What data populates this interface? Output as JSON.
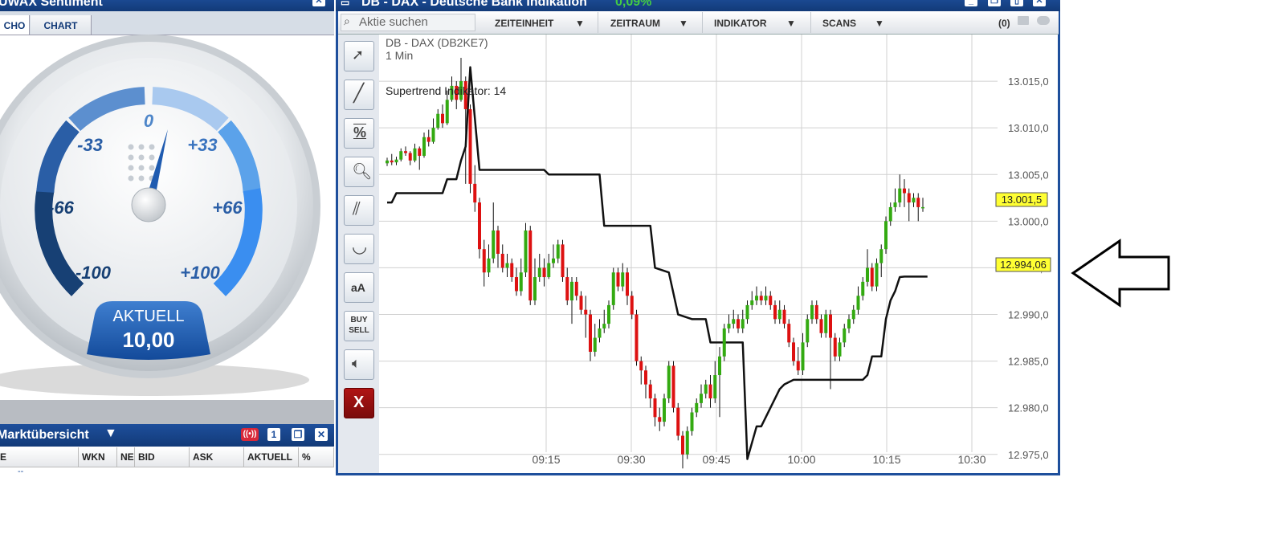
{
  "sentiment_window": {
    "title": "UWAX Sentiment",
    "tabs": [
      "CHO",
      "CHART"
    ],
    "gauge": {
      "labels": [
        "-100",
        "-66",
        "-33",
        "0",
        "+33",
        "+66",
        "+100"
      ],
      "current_label": "AKTUELL",
      "current_value": "10,00",
      "needle_value": 10
    }
  },
  "market_window": {
    "title": "Marktübersicht",
    "badge": "1",
    "columns": [
      "E",
      "WKN",
      "NE",
      "BID",
      "ASK",
      "AKTUELL",
      "%"
    ],
    "row_placeholder": "--"
  },
  "chart_window": {
    "title": "DB - DAX - Deutsche Bank Indikation",
    "change": "0,09%",
    "search_placeholder": "Aktie suchen",
    "menus": [
      "ZEITEINHEIT",
      "ZEITRAUM",
      "INDIKATOR",
      "SCANS"
    ],
    "count": "(0)",
    "symbol": "DB - DAX (DB2KE7)",
    "interval": "1 Min",
    "indicator": "Supertrend Indikator: 14",
    "price_tags": [
      "13.001,5",
      "12.994,06"
    ],
    "tools": [
      "cursor-plus",
      "line",
      "percent",
      "zoom",
      "parallel-lines",
      "arc",
      "aA",
      "BUY SELL",
      "speaker",
      "X"
    ]
  },
  "chart_data": {
    "type": "candlestick",
    "x_ticks": [
      "09:15",
      "09:30",
      "09:45",
      "10:00",
      "10:15",
      "10:30"
    ],
    "y_ticks": [
      "13.015,0",
      "13.010,0",
      "13.005,0",
      "13.000,0",
      "12.995,0",
      "12.990,0",
      "12.985,0",
      "12.980,0",
      "12.975,0"
    ],
    "ylim": [
      12973,
      13020
    ],
    "candles": [
      [
        13006.2,
        13006.5,
        13006.8,
        13005.9
      ],
      [
        13006.5,
        13006.3,
        13007.2,
        13006.0
      ],
      [
        13006.3,
        13006.6,
        13006.9,
        13006.0
      ],
      [
        13006.6,
        13007.5,
        13007.8,
        13006.4
      ],
      [
        13007.5,
        13007.3,
        13008.0,
        13007.0
      ],
      [
        13007.3,
        13006.5,
        13007.5,
        13006.0
      ],
      [
        13006.5,
        13007.8,
        13008.3,
        13006.3
      ],
      [
        13007.8,
        13007.0,
        13008.0,
        13005.5
      ],
      [
        13007.0,
        13009.0,
        13009.5,
        13006.8
      ],
      [
        13009.0,
        13008.5,
        13009.8,
        13008.0
      ],
      [
        13008.5,
        13010.0,
        13011.0,
        13008.3
      ],
      [
        13010.0,
        13011.5,
        13012.0,
        13009.8
      ],
      [
        13011.5,
        13010.5,
        13012.5,
        13010.0
      ],
      [
        13010.5,
        13013.0,
        13014.0,
        13010.3
      ],
      [
        13013.0,
        13014.5,
        13015.5,
        13012.8
      ],
      [
        13014.5,
        13013.0,
        13015.0,
        13012.0
      ],
      [
        13013.0,
        13015.0,
        13017.5,
        13012.8
      ],
      [
        13015.0,
        13012.0,
        13015.5,
        13004.0
      ],
      [
        13012.0,
        13004.0,
        13012.5,
        13003.0
      ],
      [
        13004.0,
        13002.0,
        13006.0,
        13001.0
      ],
      [
        13002.0,
        12997.0,
        13002.5,
        12996.0
      ],
      [
        12997.0,
        12994.5,
        12998.0,
        12993.0
      ],
      [
        12994.5,
        12996.0,
        12997.5,
        12994.0
      ],
      [
        12996.0,
        12999.0,
        13002.0,
        12995.5
      ],
      [
        12999.0,
        12996.5,
        12999.5,
        12995.0
      ],
      [
        12996.5,
        12995.0,
        12997.5,
        12994.5
      ],
      [
        12995.0,
        12995.5,
        12996.5,
        12994.0
      ],
      [
        12995.5,
        12994.0,
        12996.0,
        12993.5
      ],
      [
        12994.0,
        12992.5,
        12995.0,
        12992.0
      ],
      [
        12992.5,
        12994.5,
        12996.0,
        12992.0
      ],
      [
        12994.5,
        12999.0,
        12999.8,
        12994.0
      ],
      [
        12999.0,
        12991.5,
        12999.5,
        12991.0
      ],
      [
        12991.5,
        12994.0,
        12996.0,
        12991.0
      ],
      [
        12994.0,
        12995.0,
        12996.5,
        12993.5
      ],
      [
        12995.0,
        12994.0,
        12996.0,
        12993.0
      ],
      [
        12994.0,
        12995.5,
        12996.5,
        12993.8
      ],
      [
        12995.5,
        12996.0,
        12997.5,
        12995.0
      ],
      [
        12996.0,
        12997.5,
        12998.0,
        12995.5
      ],
      [
        12997.5,
        12994.0,
        12998.0,
        12993.5
      ],
      [
        12994.0,
        12991.5,
        12995.0,
        12991.0
      ],
      [
        12991.5,
        12993.5,
        12994.0,
        12989.0
      ],
      [
        12993.5,
        12992.0,
        12994.0,
        12991.5
      ],
      [
        12992.0,
        12990.5,
        12992.5,
        12990.0
      ],
      [
        12990.5,
        12990.0,
        12992.0,
        12987.5
      ],
      [
        12990.0,
        12986.0,
        12990.5,
        12985.0
      ],
      [
        12986.0,
        12987.5,
        12989.0,
        12985.5
      ],
      [
        12987.5,
        12988.5,
        12989.5,
        12987.0
      ],
      [
        12988.5,
        12989.0,
        12990.5,
        12988.0
      ],
      [
        12989.0,
        12991.0,
        12991.5,
        12988.5
      ],
      [
        12991.0,
        12994.5,
        12995.0,
        12990.5
      ],
      [
        12994.5,
        12993.0,
        12995.0,
        12992.5
      ],
      [
        12993.0,
        12994.5,
        12995.5,
        12992.5
      ],
      [
        12994.5,
        12992.0,
        12995.0,
        12991.0
      ],
      [
        12992.0,
        12990.0,
        12992.5,
        12989.5
      ],
      [
        12990.0,
        12985.0,
        12990.5,
        12984.5
      ],
      [
        12985.0,
        12984.0,
        12985.5,
        12982.5
      ],
      [
        12984.0,
        12982.5,
        12984.5,
        12981.0
      ],
      [
        12982.5,
        12981.0,
        12983.0,
        12980.0
      ],
      [
        12981.0,
        12979.0,
        12981.5,
        12978.0
      ],
      [
        12979.0,
        12978.5,
        12980.0,
        12977.5
      ],
      [
        12978.5,
        12981.0,
        12981.5,
        12978.0
      ],
      [
        12981.0,
        12984.5,
        12985.0,
        12980.5
      ],
      [
        12984.5,
        12980.0,
        12985.0,
        12979.5
      ],
      [
        12980.0,
        12977.0,
        12980.5,
        12976.5
      ],
      [
        12977.0,
        12975.0,
        12977.5,
        12973.5
      ],
      [
        12975.0,
        12977.5,
        12978.0,
        12974.5
      ],
      [
        12977.5,
        12979.5,
        12980.0,
        12977.0
      ],
      [
        12979.5,
        12980.5,
        12981.0,
        12979.0
      ],
      [
        12980.5,
        12981.5,
        12982.5,
        12980.0
      ],
      [
        12981.5,
        12982.5,
        12983.0,
        12981.0
      ],
      [
        12982.5,
        12981.0,
        12983.5,
        12980.0
      ],
      [
        12981.0,
        12983.5,
        12985.0,
        12980.5
      ],
      [
        12983.5,
        12985.5,
        12986.5,
        12979.0
      ],
      [
        12985.5,
        12988.5,
        12989.0,
        12985.0
      ],
      [
        12988.5,
        12989.0,
        12990.0,
        12988.0
      ],
      [
        12989.0,
        12989.5,
        12990.5,
        12988.5
      ],
      [
        12989.5,
        12988.5,
        12990.0,
        12988.0
      ],
      [
        12988.5,
        12989.5,
        12990.5,
        12988.0
      ],
      [
        12989.5,
        12991.0,
        12991.5,
        12989.0
      ],
      [
        12991.0,
        12991.5,
        12992.5,
        12990.5
      ],
      [
        12991.5,
        12992.0,
        12993.0,
        12991.0
      ],
      [
        12992.0,
        12991.5,
        12992.5,
        12991.0
      ],
      [
        12991.5,
        12992.0,
        12993.0,
        12991.0
      ],
      [
        12992.0,
        12991.0,
        12992.5,
        12990.5
      ],
      [
        12991.0,
        12989.5,
        12991.5,
        12989.0
      ],
      [
        12989.5,
        12990.5,
        12991.5,
        12989.0
      ],
      [
        12990.5,
        12989.0,
        12991.0,
        12988.5
      ],
      [
        12989.0,
        12987.0,
        12989.5,
        12986.5
      ],
      [
        12987.0,
        12985.0,
        12987.5,
        12984.5
      ],
      [
        12985.0,
        12984.0,
        12986.5,
        12983.5
      ],
      [
        12984.0,
        12987.0,
        12988.0,
        12983.5
      ],
      [
        12987.0,
        12989.5,
        12990.0,
        12986.5
      ],
      [
        12989.5,
        12991.0,
        12991.5,
        12989.0
      ],
      [
        12991.0,
        12989.5,
        12991.5,
        12989.0
      ],
      [
        12989.5,
        12988.0,
        12990.0,
        12987.5
      ],
      [
        12988.0,
        12990.0,
        12990.5,
        12987.5
      ],
      [
        12990.0,
        12987.5,
        12990.5,
        12982.0
      ],
      [
        12987.5,
        12985.5,
        12988.0,
        12985.0
      ],
      [
        12985.5,
        12987.0,
        12987.5,
        12985.0
      ],
      [
        12987.0,
        12988.5,
        12989.0,
        12986.5
      ],
      [
        12988.5,
        12989.5,
        12990.0,
        12988.0
      ],
      [
        12989.5,
        12990.5,
        12991.0,
        12989.0
      ],
      [
        12990.5,
        12992.0,
        12993.0,
        12990.0
      ],
      [
        12992.0,
        12993.5,
        12994.0,
        12991.5
      ],
      [
        12993.5,
        12995.0,
        12997.0,
        12993.0
      ],
      [
        12995.0,
        12993.0,
        12995.5,
        12992.5
      ],
      [
        12993.0,
        12995.5,
        12996.0,
        12992.5
      ],
      [
        12995.5,
        12997.0,
        12997.5,
        12994.0
      ],
      [
        12997.0,
        13000.0,
        13000.5,
        12996.5
      ],
      [
        13000.0,
        13001.5,
        13002.0,
        12999.5
      ],
      [
        13001.5,
        13002.0,
        13003.5,
        13001.0
      ],
      [
        13002.0,
        13003.5,
        13005.0,
        13001.5
      ],
      [
        13003.5,
        13003.0,
        13004.5,
        13001.5
      ],
      [
        13003.0,
        13002.0,
        13003.5,
        13000.0
      ],
      [
        13002.0,
        13002.5,
        13003.0,
        13001.5
      ],
      [
        13002.5,
        13001.5,
        13003.0,
        13000.0
      ],
      [
        13001.5,
        13001.5,
        13002.5,
        13001.0
      ]
    ],
    "supertrend": [
      [
        0,
        13002.0
      ],
      [
        1,
        13002.0
      ],
      [
        2,
        13003.0
      ],
      [
        12,
        13003.0
      ],
      [
        13,
        13004.5
      ],
      [
        15,
        13004.5
      ],
      [
        16,
        13006.5
      ],
      [
        17,
        13008.0
      ],
      [
        18,
        13016.5
      ],
      [
        19,
        13011.0
      ],
      [
        20,
        13005.5
      ],
      [
        34,
        13005.5
      ],
      [
        35,
        13005.0
      ],
      [
        46,
        13005.0
      ],
      [
        47,
        12999.5
      ],
      [
        57,
        12999.5
      ],
      [
        58,
        12995.0
      ],
      [
        61,
        12994.5
      ],
      [
        63,
        12990.0
      ],
      [
        66,
        12989.5
      ],
      [
        69,
        12989.5
      ],
      [
        70,
        12987.0
      ],
      [
        77,
        12987.0
      ],
      [
        78,
        12974.5
      ],
      [
        80,
        12978.0
      ],
      [
        81,
        12978.0
      ],
      [
        83,
        12980.0
      ],
      [
        84,
        12981.0
      ],
      [
        85,
        12982.0
      ],
      [
        86,
        12982.5
      ],
      [
        88,
        12983.0
      ],
      [
        103,
        12983.0
      ],
      [
        104,
        12983.5
      ],
      [
        105,
        12985.5
      ],
      [
        107,
        12985.5
      ],
      [
        108,
        12989.5
      ],
      [
        109,
        12991.5
      ],
      [
        110,
        12992.5
      ],
      [
        111,
        12994.0
      ],
      [
        112,
        12994.06
      ],
      [
        117,
        12994.06
      ]
    ]
  },
  "colors": {
    "title_bg": "#1e4f9c",
    "up": "#33aa11",
    "down": "#dd1111",
    "grid": "#d0d0d0",
    "price_tag": "#ffff33",
    "close_btn": "#8b0e0e"
  }
}
